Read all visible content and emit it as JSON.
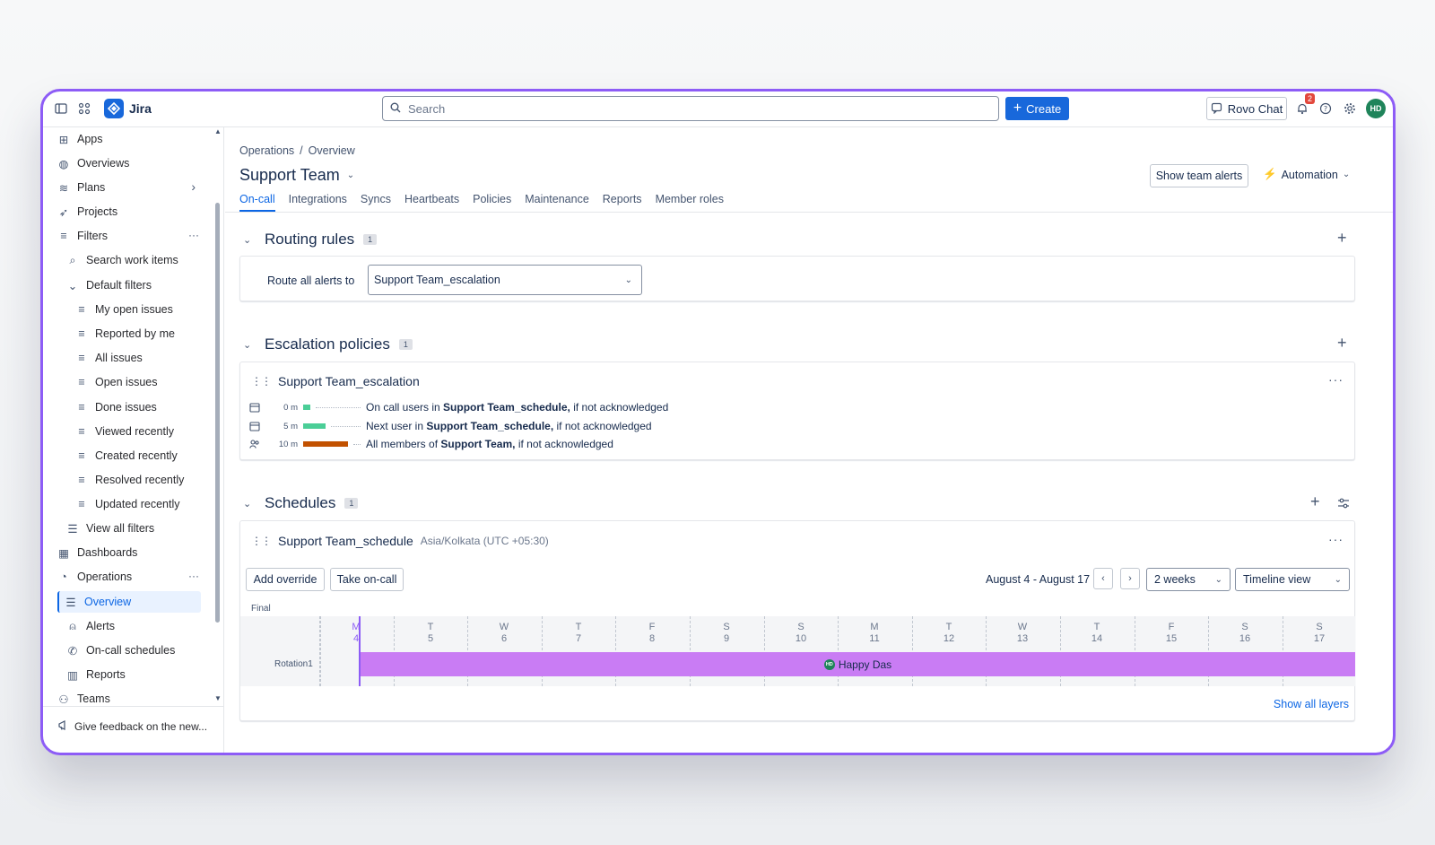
{
  "topbar": {
    "app_name": "Jira",
    "search_placeholder": "Search",
    "create_label": "Create",
    "rovo_label": "Rovo Chat",
    "notification_count": "2",
    "avatar_initials": "HD"
  },
  "sidebar": {
    "items": [
      {
        "label": "Apps",
        "icon": "apps-icon"
      },
      {
        "label": "Overviews",
        "icon": "globe-icon"
      },
      {
        "label": "Plans",
        "icon": "plans-icon"
      },
      {
        "label": "Projects",
        "icon": "rocket-icon"
      },
      {
        "label": "Filters",
        "icon": "filter-icon"
      },
      {
        "label": "Search work items",
        "icon": "search-icon"
      },
      {
        "label": "Default filters",
        "icon": "chevron-down-icon"
      },
      {
        "label": "My open issues",
        "icon": "filter-icon"
      },
      {
        "label": "Reported by me",
        "icon": "filter-icon"
      },
      {
        "label": "All issues",
        "icon": "filter-icon"
      },
      {
        "label": "Open issues",
        "icon": "filter-icon"
      },
      {
        "label": "Done issues",
        "icon": "filter-icon"
      },
      {
        "label": "Viewed recently",
        "icon": "filter-icon"
      },
      {
        "label": "Created recently",
        "icon": "filter-icon"
      },
      {
        "label": "Resolved recently",
        "icon": "filter-icon"
      },
      {
        "label": "Updated recently",
        "icon": "filter-icon"
      },
      {
        "label": "View all filters",
        "icon": "list-icon"
      },
      {
        "label": "Dashboards",
        "icon": "dashboard-icon"
      },
      {
        "label": "Operations",
        "icon": "operations-icon"
      },
      {
        "label": "Overview",
        "icon": "list-icon"
      },
      {
        "label": "Alerts",
        "icon": "alert-icon"
      },
      {
        "label": "On-call schedules",
        "icon": "phone-icon"
      },
      {
        "label": "Reports",
        "icon": "chart-icon"
      },
      {
        "label": "Teams",
        "icon": "people-icon"
      }
    ],
    "feedback_label": "Give feedback on the new..."
  },
  "main": {
    "breadcrumb": {
      "parent": "Operations",
      "separator": "/",
      "current": "Overview"
    },
    "title": "Support Team",
    "show_alerts_label": "Show team alerts",
    "automation_label": "Automation",
    "tabs": [
      "On-call",
      "Integrations",
      "Syncs",
      "Heartbeats",
      "Policies",
      "Maintenance",
      "Reports",
      "Member roles"
    ],
    "routing": {
      "title": "Routing rules",
      "count": "1",
      "route_label": "Route all alerts to",
      "route_value": "Support Team_escalation"
    },
    "escalation": {
      "title": "Escalation policies",
      "count": "1",
      "policy_name": "Support Team_escalation",
      "rows": [
        {
          "time": "0 m",
          "pre": "On call users in ",
          "bold": "Support Team_schedule,",
          "post": " if not acknowledged",
          "bar_color": "#4bce97",
          "bar_fraction": 0.15
        },
        {
          "time": "5 m",
          "pre": "Next user in ",
          "bold": "Support Team_schedule,",
          "post": " if not acknowledged",
          "bar_color": "#4bce97",
          "bar_fraction": 0.5
        },
        {
          "time": "10 m",
          "pre": "All members of ",
          "bold": "Support Team,",
          "post": " if not acknowledged",
          "bar_color": "#c25100",
          "bar_fraction": 1.0
        }
      ]
    },
    "schedules": {
      "title": "Schedules",
      "count": "1",
      "schedule_name": "Support Team_schedule",
      "timezone": "Asia/Kolkata (UTC +05:30)",
      "add_override_label": "Add override",
      "take_oncall_label": "Take on-call",
      "date_range": "August 4 - August 17",
      "period_value": "2 weeks",
      "view_value": "Timeline view",
      "final_label": "Final",
      "days": [
        {
          "letter": "M",
          "num": "4"
        },
        {
          "letter": "T",
          "num": "5"
        },
        {
          "letter": "W",
          "num": "6"
        },
        {
          "letter": "T",
          "num": "7"
        },
        {
          "letter": "F",
          "num": "8"
        },
        {
          "letter": "S",
          "num": "9"
        },
        {
          "letter": "S",
          "num": "10"
        },
        {
          "letter": "M",
          "num": "11"
        },
        {
          "letter": "T",
          "num": "12"
        },
        {
          "letter": "W",
          "num": "13"
        },
        {
          "letter": "T",
          "num": "14"
        },
        {
          "letter": "F",
          "num": "15"
        },
        {
          "letter": "S",
          "num": "16"
        },
        {
          "letter": "S",
          "num": "17"
        }
      ],
      "rotation_label": "Rotation1",
      "rotation_user": "Happy Das",
      "rotation_user_initials": "HD",
      "show_all_layers_label": "Show all layers"
    }
  }
}
